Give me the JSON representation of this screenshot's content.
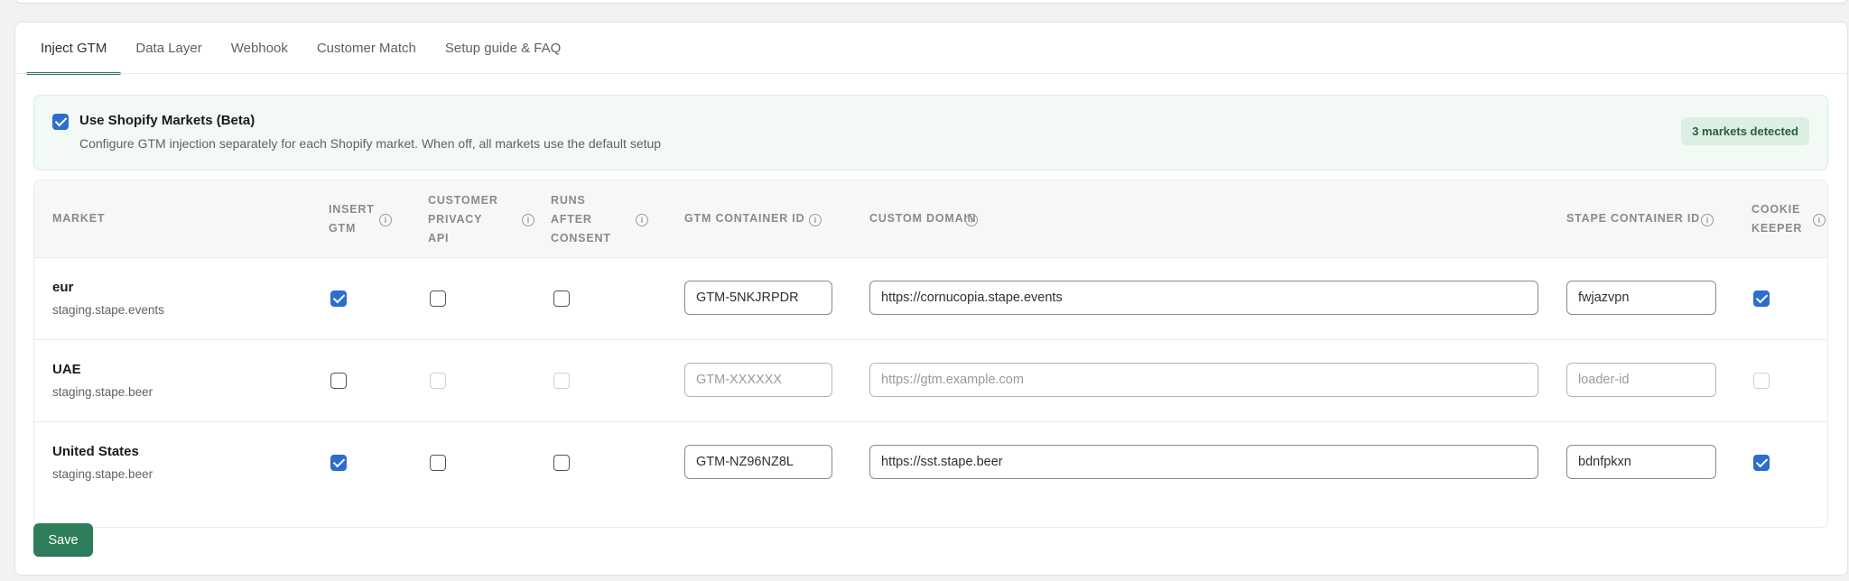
{
  "tabs": [
    "Inject GTM",
    "Data Layer",
    "Webhook",
    "Customer Match",
    "Setup guide & FAQ"
  ],
  "banner": {
    "title": "Use Shopify Markets (Beta)",
    "description": "Configure GTM injection separately for each Shopify market. When off, all markets use the default setup",
    "badge": "3 markets detected",
    "checked": true
  },
  "columns": {
    "market": "MARKET",
    "insert_gtm": [
      "INSERT",
      "GTM"
    ],
    "privacy_api": [
      "CUSTOMER",
      "PRIVACY",
      "API"
    ],
    "runs_after": [
      "RUNS",
      "AFTER",
      "CONSENT"
    ],
    "container_id": "GTM CONTAINER ID",
    "custom_domain": "CUSTOM DOMAIN",
    "stape_id": "STAPE CONTAINER ID",
    "cookie_keeper": [
      "COOKIE",
      "KEEPER"
    ]
  },
  "rows": [
    {
      "name": "eur",
      "domain": "staging.stape.events",
      "insert_gtm": true,
      "privacy_api": false,
      "runs_after": false,
      "gtm_id": "GTM-5NKJRPDR",
      "gtm_placeholder": "GTM-XXXXXX",
      "custom_domain": "https://cornucopia.stape.events",
      "domain_placeholder": "https://gtm.example.com",
      "stape_id": "fwjazvpn",
      "stape_placeholder": "loader-id",
      "cookie_keeper": true,
      "disabled": false
    },
    {
      "name": "UAE",
      "domain": "staging.stape.beer",
      "insert_gtm": false,
      "privacy_api": false,
      "runs_after": false,
      "gtm_id": "",
      "gtm_placeholder": "GTM-XXXXXX",
      "custom_domain": "",
      "domain_placeholder": "https://gtm.example.com",
      "stape_id": "",
      "stape_placeholder": "loader-id",
      "cookie_keeper": false,
      "disabled": true
    },
    {
      "name": "United States",
      "domain": "staging.stape.beer",
      "insert_gtm": true,
      "privacy_api": false,
      "runs_after": false,
      "gtm_id": "GTM-NZ96NZ8L",
      "gtm_placeholder": "GTM-XXXXXX",
      "custom_domain": "https://sst.stape.beer",
      "domain_placeholder": "https://gtm.example.com",
      "stape_id": "bdnfpkxn",
      "stape_placeholder": "loader-id",
      "cookie_keeper": true,
      "disabled": false
    }
  ],
  "save_label": "Save",
  "colors": {
    "accent": "#2e7d5b",
    "checkbox": "#2c6ecb",
    "banner_bg": "#f3faf5"
  }
}
